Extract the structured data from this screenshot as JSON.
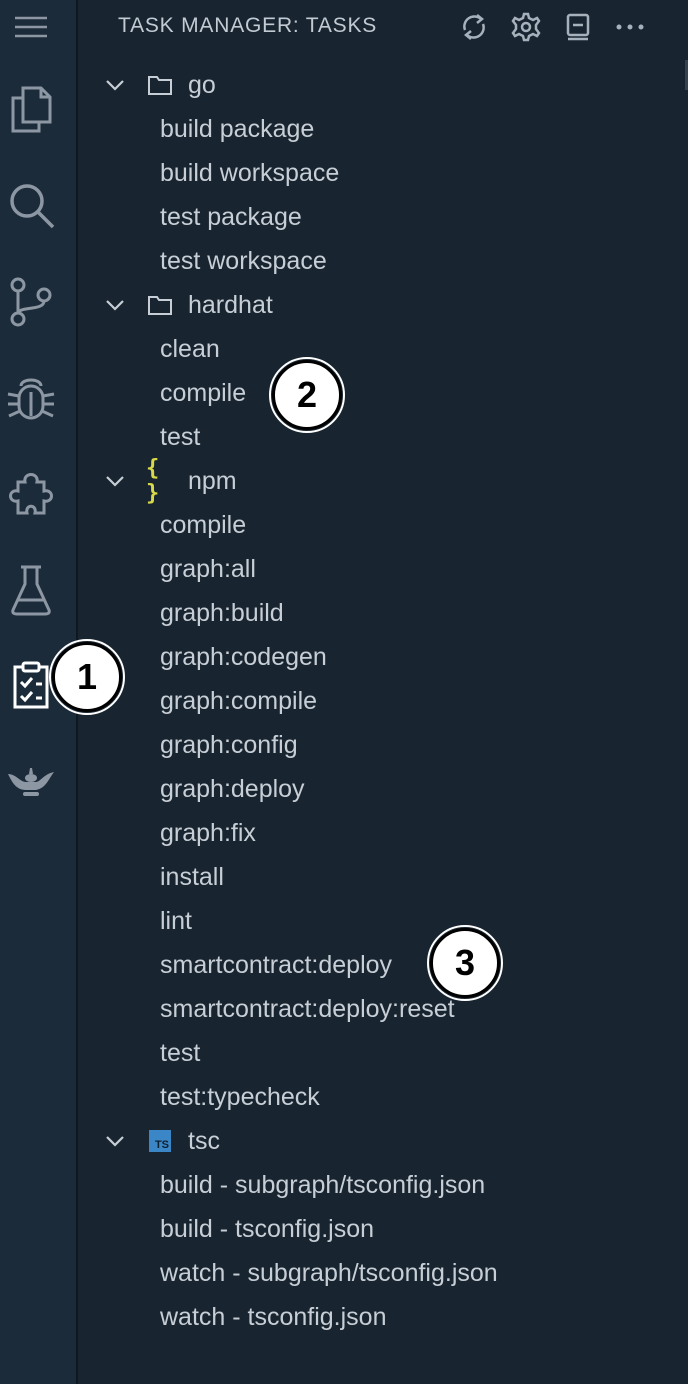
{
  "header": {
    "title": "TASK MANAGER: TASKS"
  },
  "activity_bar": {
    "items": [
      "menu-icon",
      "explorer-icon",
      "search-icon",
      "source-control-icon",
      "debug-icon",
      "extensions-icon",
      "testing-icon",
      "task-manager-icon",
      "lamp-icon"
    ]
  },
  "groups": [
    {
      "label": "go",
      "icon": "folder-icon",
      "tasks": [
        "build package",
        "build workspace",
        "test package",
        "test workspace"
      ]
    },
    {
      "label": "hardhat",
      "icon": "folder-icon",
      "tasks": [
        "clean",
        "compile",
        "test"
      ]
    },
    {
      "label": "npm",
      "icon": "json-icon",
      "icon_text": "{ }",
      "tasks": [
        "compile",
        "graph:all",
        "graph:build",
        "graph:codegen",
        "graph:compile",
        "graph:config",
        "graph:deploy",
        "graph:fix",
        "install",
        "lint",
        "smartcontract:deploy",
        "smartcontract:deploy:reset",
        "test",
        "test:typecheck"
      ]
    },
    {
      "label": "tsc",
      "icon": "typescript-icon",
      "icon_text": "TS",
      "tasks": [
        "build - subgraph/tsconfig.json",
        "build - tsconfig.json",
        "watch - subgraph/tsconfig.json",
        "watch - tsconfig.json"
      ]
    }
  ],
  "callouts": [
    "1",
    "2",
    "3"
  ],
  "colors": {
    "background": "#182530",
    "activity_bar": "#1c2b3a",
    "text": "#c7ced6",
    "npm_icon": "#d7d94a",
    "ts_icon": "#3a86c6"
  }
}
